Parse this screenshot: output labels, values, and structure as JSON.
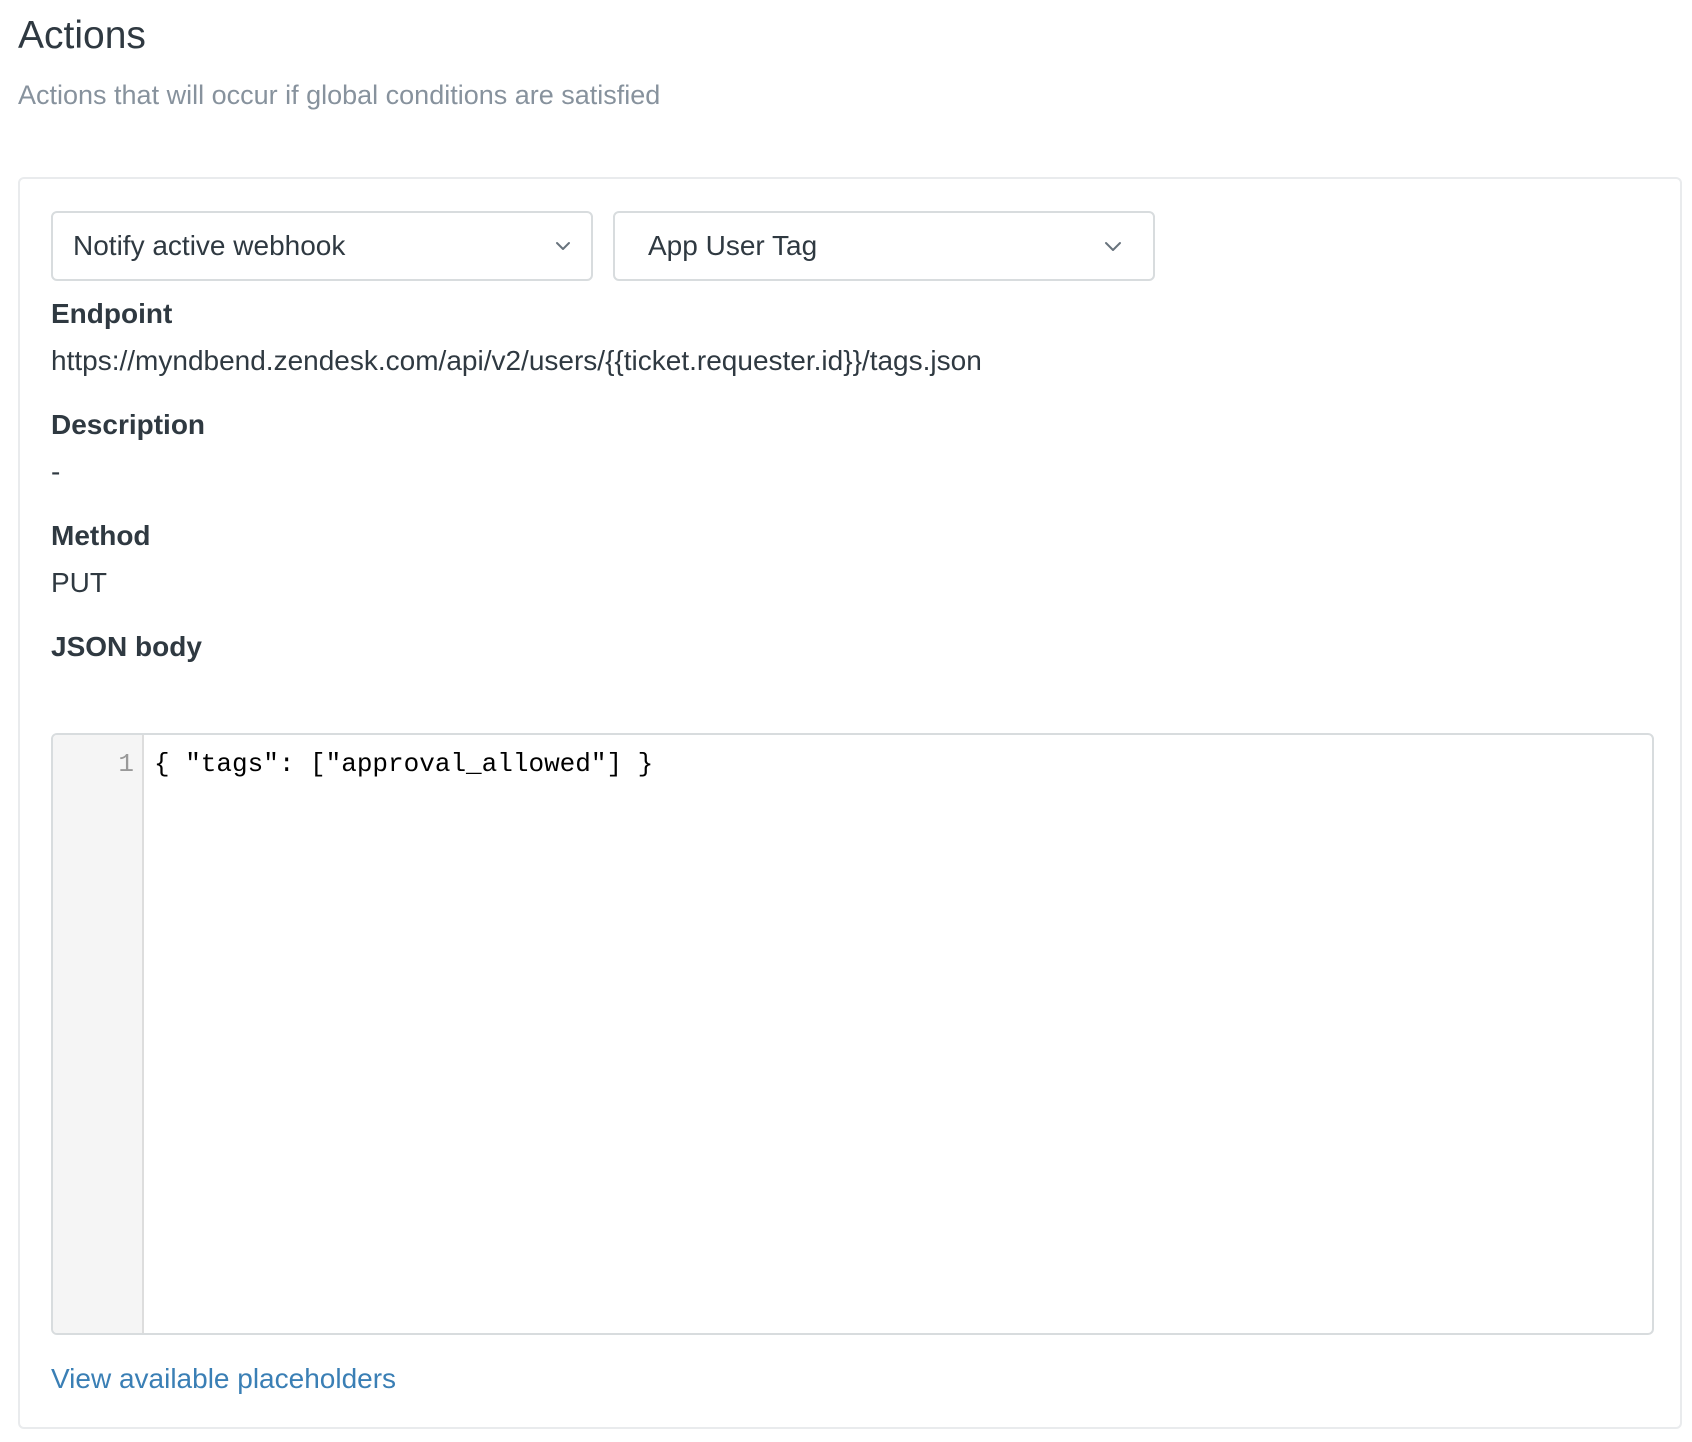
{
  "header": {
    "title": "Actions",
    "subtitle": "Actions that will occur if global conditions are satisfied"
  },
  "action": {
    "type_select": {
      "value": "Notify active webhook",
      "icon": "chevron-down-icon"
    },
    "webhook_select": {
      "value": "App User Tag",
      "icon": "chevron-down-icon"
    },
    "fields": {
      "endpoint_label": "Endpoint",
      "endpoint_value": "https://myndbend.zendesk.com/api/v2/users/{{ticket.requester.id}}/tags.json",
      "description_label": "Description",
      "description_value": "-",
      "method_label": "Method",
      "method_value": "PUT",
      "json_body_label": "JSON body"
    },
    "editor": {
      "line_number": "1",
      "code": "{ \"tags\": [\"approval_allowed\"] }"
    },
    "placeholders_link": "View available placeholders"
  },
  "colors": {
    "text_primary": "#2f3941",
    "text_muted": "#87929d",
    "border": "#d8dcde",
    "link": "#3a7fb5",
    "gutter_bg": "#f5f5f5"
  }
}
